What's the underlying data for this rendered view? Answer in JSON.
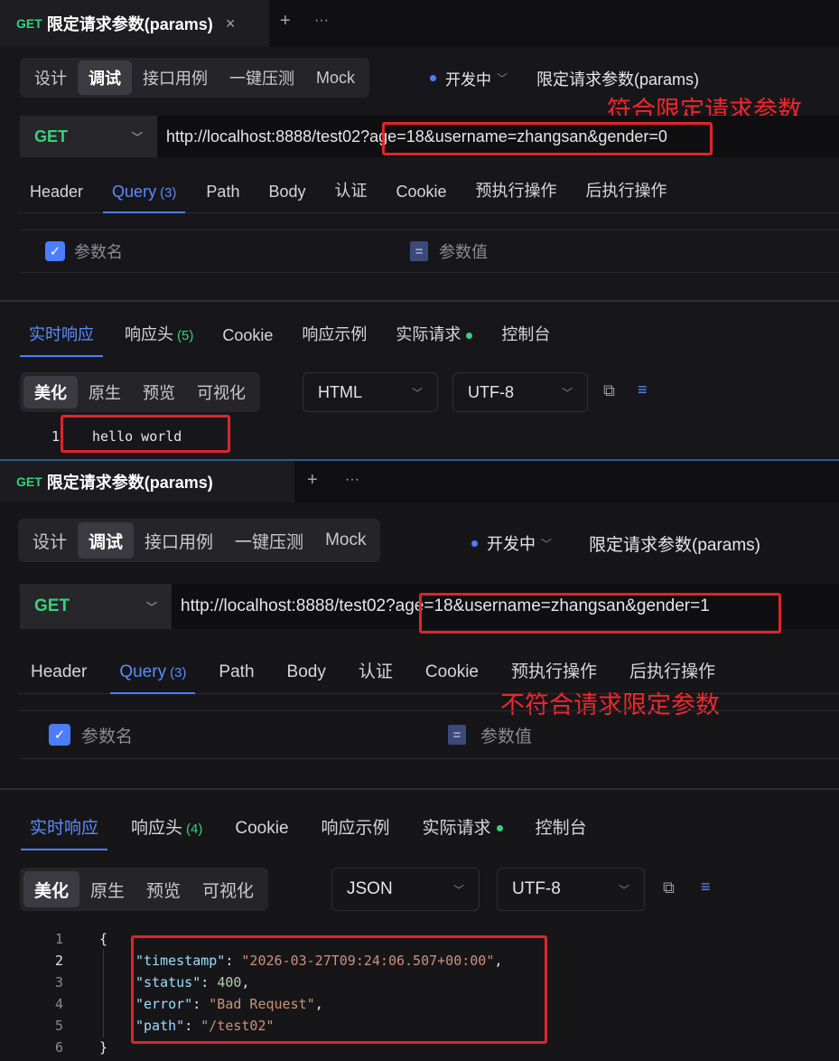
{
  "top": {
    "tab": {
      "method": "GET",
      "title": "限定请求参数(params)",
      "close": "×"
    },
    "add_icon": "+",
    "more_icon": "···",
    "modes": [
      "设计",
      "调试",
      "接口用例",
      "一键压测",
      "Mock"
    ],
    "active_mode": "调试",
    "env": "开发中",
    "api_name": "限定请求参数(params)",
    "annotation": "符合限定请求参数",
    "method": "GET",
    "url": "http://localhost:8888/test02?age=18&username=zhangsan&gender=0",
    "request_tabs": {
      "header": "Header",
      "query": "Query",
      "query_count": "(3)",
      "path": "Path",
      "body": "Body",
      "auth": "认证",
      "cookie": "Cookie",
      "pre": "预执行操作",
      "post": "后执行操作"
    },
    "param_name_label": "参数名",
    "param_value_label": "参数值",
    "eq_symbol": "=",
    "response_tabs": {
      "live": "实时响应",
      "headers": "响应头",
      "headers_count": "(5)",
      "cookie": "Cookie",
      "example": "响应示例",
      "actual": "实际请求",
      "console": "控制台"
    },
    "views": [
      "美化",
      "原生",
      "预览",
      "可视化"
    ],
    "format": "HTML",
    "encoding": "UTF-8",
    "body_lines": [
      {
        "no": "1",
        "text": "hello world"
      }
    ]
  },
  "bottom": {
    "tab": {
      "method": "GET",
      "title": "限定请求参数(params)"
    },
    "add_icon": "+",
    "more_icon": "···",
    "modes": [
      "设计",
      "调试",
      "接口用例",
      "一键压测",
      "Mock"
    ],
    "active_mode": "调试",
    "env": "开发中",
    "api_name": "限定请求参数(params)",
    "annotation": "不符合请求限定参数",
    "method": "GET",
    "url": "http://localhost:8888/test02?age=18&username=zhangsan&gender=1",
    "request_tabs": {
      "header": "Header",
      "query": "Query",
      "query_count": "(3)",
      "path": "Path",
      "body": "Body",
      "auth": "认证",
      "cookie": "Cookie",
      "pre": "预执行操作",
      "post": "后执行操作"
    },
    "param_name_label": "参数名",
    "param_value_label": "参数值",
    "eq_symbol": "=",
    "response_tabs": {
      "live": "实时响应",
      "headers": "响应头",
      "headers_count": "(4)",
      "cookie": "Cookie",
      "example": "响应示例",
      "actual": "实际请求",
      "console": "控制台"
    },
    "views": [
      "美化",
      "原生",
      "预览",
      "可视化"
    ],
    "format": "JSON",
    "encoding": "UTF-8",
    "line_numbers": [
      "1",
      "2",
      "3",
      "4",
      "5",
      "6"
    ],
    "json": {
      "open": "{",
      "close": "}",
      "timestamp_key": "\"timestamp\"",
      "timestamp_val": "\"2026-03-27T09:24:06.507+00:00\"",
      "status_key": "\"status\"",
      "status_val": "400",
      "error_key": "\"error\"",
      "error_val": "\"Bad Request\"",
      "path_key": "\"path\"",
      "path_val": "\"/test02\""
    }
  },
  "colors": {
    "accent": "#4c7dff",
    "get_method": "#3ad17a",
    "annotation": "#e0242b"
  }
}
